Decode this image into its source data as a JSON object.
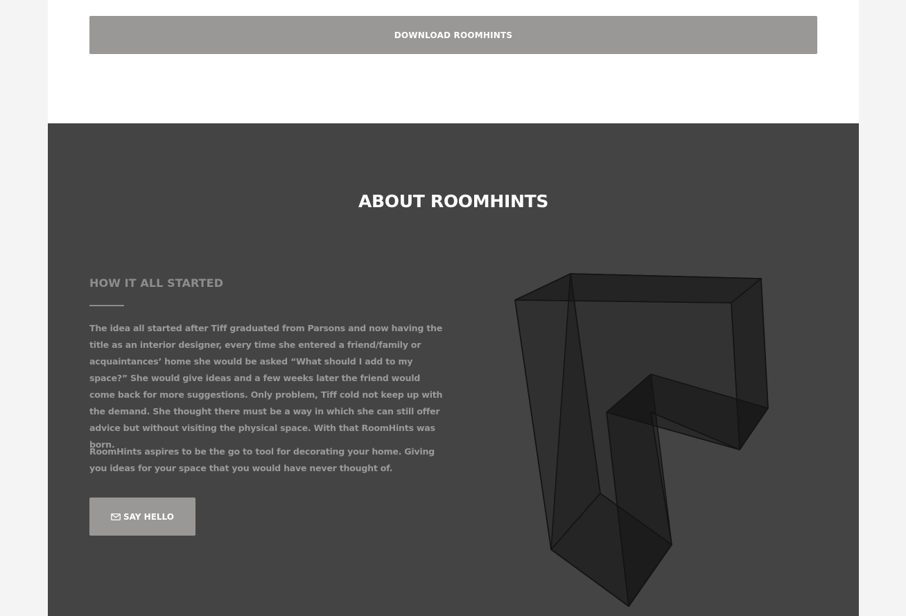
{
  "download": {
    "label": "DOWNLOAD ROOMHINTS"
  },
  "about": {
    "title": "ABOUT ROOMHINTS",
    "subheading": "HOW IT ALL STARTED",
    "paragraphs": [
      "The idea all started after Tiff graduated from Parsons and now having the title as an interior designer, every time she entered a friend/family or acquaintances’ home she would be asked “What should I add to my space?” She would give ideas and a few weeks later the friend would come back for more suggestions. Only problem, Tiff cold not keep up with the demand. She thought there must be a way in which she can still offer advice but without visiting the physical space. With that RoomHints was born.",
      "RoomHints aspires to be the go to tool for decorating your home. Giving you ideas for your space that you would have never thought of."
    ],
    "cta": {
      "label": "SAY HELLO",
      "icon": "envelope-icon"
    },
    "graphic": "roomhints-3d-logo"
  },
  "colors": {
    "page_background": "#f4f4f4",
    "content_background": "#ffffff",
    "about_background": "#444444",
    "button_background": "#999896",
    "muted_text": "#9a9a9a"
  }
}
